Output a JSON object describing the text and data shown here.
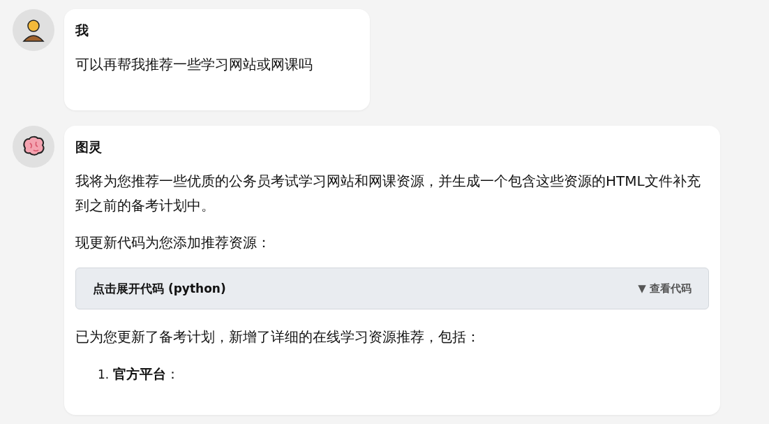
{
  "messages": [
    {
      "sender": "我",
      "kind": "user",
      "blocks": [
        {
          "kind": "paragraph",
          "text": "可以再帮我推荐一些学习网站或网课吗"
        }
      ]
    },
    {
      "sender": "图灵",
      "kind": "bot",
      "blocks": [
        {
          "kind": "paragraph",
          "text": "我将为您推荐一些优质的公务员考试学习网站和网课资源，并生成一个包含这些资源的HTML文件补充到之前的备考计划中。"
        },
        {
          "kind": "paragraph",
          "text": "现更新代码为您添加推荐资源："
        },
        {
          "kind": "code",
          "label": "点击展开代码 (python)",
          "toggle": "▼ 查看代码"
        },
        {
          "kind": "paragraph",
          "text": "已为您更新了备考计划，新增了详细的在线学习资源推荐，包括："
        },
        {
          "kind": "list",
          "items": [
            {
              "number": "1.",
              "text": "**官方平台**："
            }
          ]
        }
      ]
    }
  ]
}
